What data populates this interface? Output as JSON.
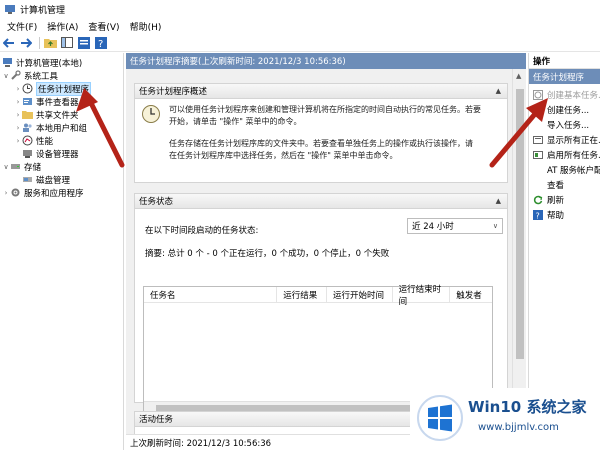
{
  "window": {
    "title": "计算机管理"
  },
  "menu": [
    "文件(F)",
    "操作(A)",
    "查看(V)",
    "帮助(H)"
  ],
  "tree": {
    "root": "计算机管理(本地)",
    "system_tools": "系统工具",
    "task_scheduler": "任务计划程序",
    "event_viewer": "事件查看器",
    "shared_folders": "共享文件夹",
    "local_users": "本地用户和组",
    "performance": "性能",
    "device_manager": "设备管理器",
    "storage": "存储",
    "disk_management": "磁盘管理",
    "services_apps": "服务和应用程序"
  },
  "center": {
    "header": "任务计划程序摘要(上次刷新时间: 2021/12/3 10:56:36)",
    "overview_title": "任务计划程序概述",
    "overview_text_1": "可以使用任务计划程序来创建和管理计算机将在所指定的时间自动执行的常见任务。若要",
    "overview_text_2": "开始，请单击 \"操作\" 菜单中的命令。",
    "overview_text_3": "任务存储在任务计划程序库的文件夹中。若要查看单独任务上的操作或执行该操作，请",
    "overview_text_4": "在任务计划程序库中选择任务，然后在 \"操作\" 菜单中单击命令。",
    "status_title": "任务状态",
    "status_label": "在以下时间段启动的任务状态:",
    "status_range": "近 24 小时",
    "summary": "摘要: 总计 0 个 - 0 个正在运行，0 个成功，0 个停止，0 个失败",
    "columns": [
      "任务名",
      "运行结果",
      "运行开始时间",
      "运行结束时间",
      "触发者"
    ],
    "active_title": "活动任务",
    "footer": "上次刷新时间: 2021/12/3 10:56:36"
  },
  "actions": {
    "title": "操作",
    "group": "任务计划程序",
    "items": [
      "创建基本任务...",
      "创建任务...",
      "导入任务...",
      "显示所有正在...",
      "启用所有任务...",
      "AT 服务帐户配...",
      "查看",
      "刷新",
      "帮助"
    ]
  },
  "watermark": {
    "brand": "Win10 系统之家",
    "url": "www.bjjmlv.com"
  },
  "colors": {
    "header_bg": "#6d8db8",
    "arrow": "#b42318"
  }
}
